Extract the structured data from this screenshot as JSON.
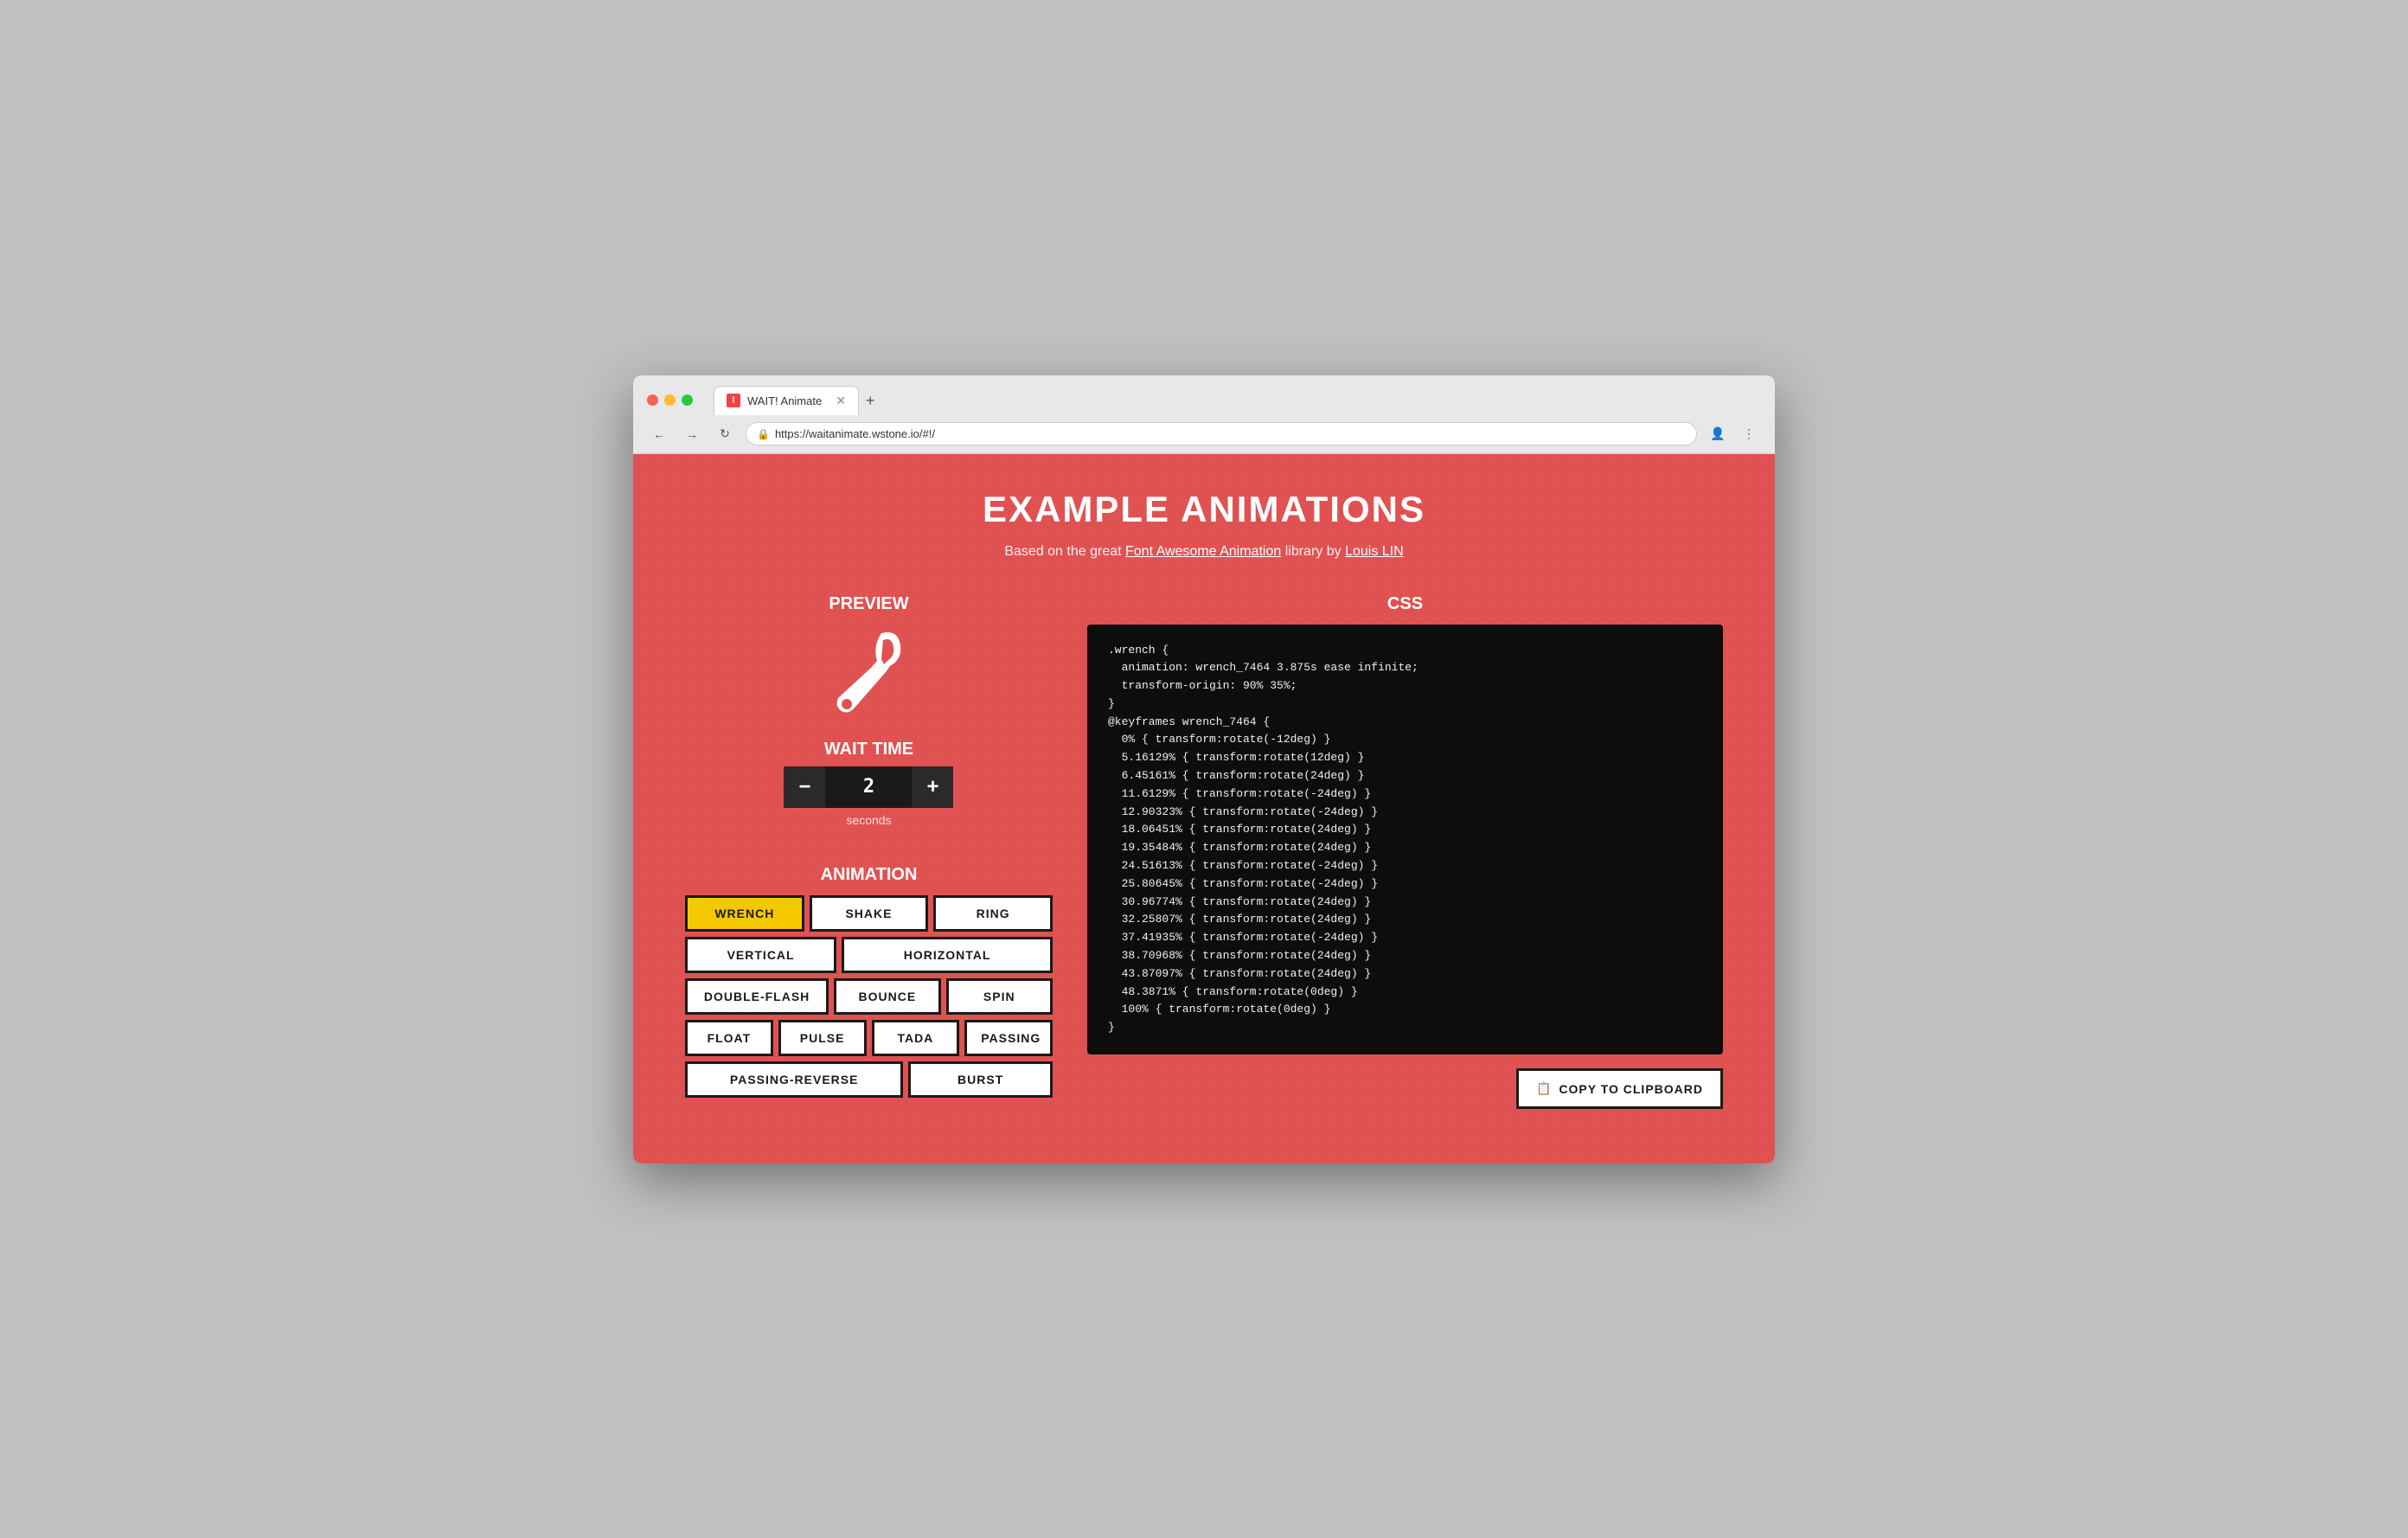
{
  "browser": {
    "tab_title": "WAIT! Animate",
    "tab_favicon_text": "!",
    "url": "https://waitanimate.wstone.io/#!/",
    "back_tooltip": "Back",
    "forward_tooltip": "Forward",
    "reload_tooltip": "Reload"
  },
  "page": {
    "title": "EXAMPLE ANIMATIONS",
    "subtitle_prefix": "Based on the great ",
    "subtitle_link1": "Font Awesome Animation",
    "subtitle_middle": " library by ",
    "subtitle_link2": "Louis LIN"
  },
  "preview": {
    "label": "Preview",
    "wait_time_label": "Wait time",
    "wait_value": "2",
    "seconds_label": "seconds",
    "minus_label": "−",
    "plus_label": "+"
  },
  "animation": {
    "label": "Animation",
    "buttons": [
      {
        "id": "wrench",
        "label": "WRENCH",
        "active": true
      },
      {
        "id": "shake",
        "label": "SHAKE",
        "active": false
      },
      {
        "id": "ring",
        "label": "RING",
        "active": false
      },
      {
        "id": "vertical",
        "label": "VERTICAL",
        "active": false
      },
      {
        "id": "horizontal",
        "label": "HORIZONTAL",
        "active": false
      },
      {
        "id": "double-flash",
        "label": "DOUBLE-FLASH",
        "active": false
      },
      {
        "id": "bounce",
        "label": "BOUNCE",
        "active": false
      },
      {
        "id": "spin",
        "label": "SPIN",
        "active": false
      },
      {
        "id": "float",
        "label": "FLOAT",
        "active": false
      },
      {
        "id": "pulse",
        "label": "PULSE",
        "active": false
      },
      {
        "id": "tada",
        "label": "TADA",
        "active": false
      },
      {
        "id": "passing",
        "label": "PASSING",
        "active": false
      },
      {
        "id": "passing-reverse",
        "label": "PASSING-REVERSE",
        "active": false
      },
      {
        "id": "burst",
        "label": "BURST",
        "active": false
      }
    ]
  },
  "css": {
    "label": "CSS",
    "code_lines": [
      ".wrench {",
      "  animation: wrench_7464 3.875s ease infinite;",
      "  transform-origin: 90% 35%;",
      "}",
      "",
      "@keyframes wrench_7464 {",
      "  0% { transform:rotate(-12deg) }",
      "  5.16129% { transform:rotate(12deg) }",
      "  6.45161% { transform:rotate(24deg) }",
      "  11.6129% { transform:rotate(-24deg) }",
      "  12.90323% { transform:rotate(-24deg) }",
      "  18.06451% { transform:rotate(24deg) }",
      "  19.35484% { transform:rotate(24deg) }",
      "  24.51613% { transform:rotate(-24deg) }",
      "  25.80645% { transform:rotate(-24deg) }",
      "  30.96774% { transform:rotate(24deg) }",
      "  32.25807% { transform:rotate(24deg) }",
      "  37.41935% { transform:rotate(-24deg) }",
      "  38.70968% { transform:rotate(24deg) }",
      "  43.87097% { transform:rotate(24deg) }",
      "  48.3871% { transform:rotate(0deg) }",
      "  100% { transform:rotate(0deg) }",
      "}"
    ],
    "copy_button_label": "COPY TO CLIPBOARD",
    "copy_icon": "📋"
  }
}
